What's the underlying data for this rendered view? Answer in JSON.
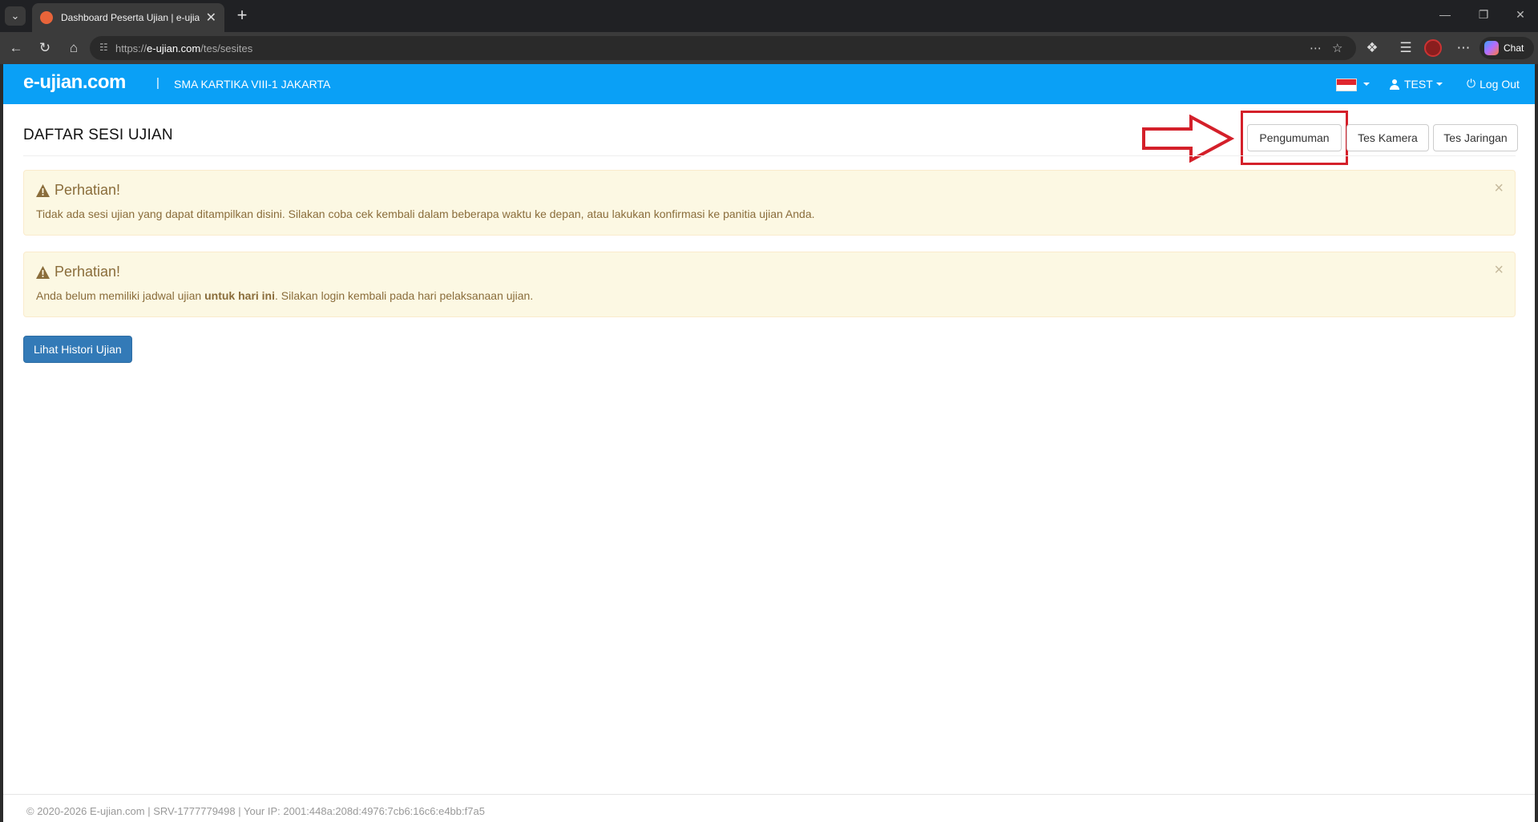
{
  "browser": {
    "tab_title": "Dashboard Peserta Ujian | e-ujian.c",
    "url_prefix": "https://",
    "url_domain": "e-ujian.com",
    "url_path": "/tes/sesites",
    "chat_label": "Chat"
  },
  "header": {
    "brand": "e-ujian.com",
    "separator": "|",
    "school": "SMA KARTIKA VIII-1 JAKARTA",
    "user": "TEST",
    "logout": "Log Out"
  },
  "page": {
    "title": "DAFTAR SESI UJIAN",
    "buttons": {
      "announcement": "Pengumuman",
      "camera_test": "Tes Kamera",
      "network_test": "Tes Jaringan"
    }
  },
  "alerts": [
    {
      "heading": "Perhatian!",
      "body": "Tidak ada sesi ujian yang dapat ditampilkan disini. Silakan coba cek kembali dalam beberapa waktu ke depan, atau lakukan konfirmasi ke panitia ujian Anda."
    },
    {
      "heading": "Perhatian!",
      "body_pre": "Anda belum memiliki jadwal ujian ",
      "body_bold": "untuk hari ini",
      "body_post": ". Silakan login kembali pada hari pelaksanaan ujian."
    }
  ],
  "history_button": "Lihat Histori Ujian",
  "footer": "© 2020-2026 E-ujian.com | SRV-1777779498 | Your IP: 2001:448a:208d:4976:7cb6:16c6:e4bb:f7a5",
  "colors": {
    "header_bg": "#0aa0f6",
    "alert_bg": "#fcf8e3",
    "alert_text": "#8a6d3b",
    "primary": "#337ab7",
    "annotation_red": "#d4202a"
  }
}
